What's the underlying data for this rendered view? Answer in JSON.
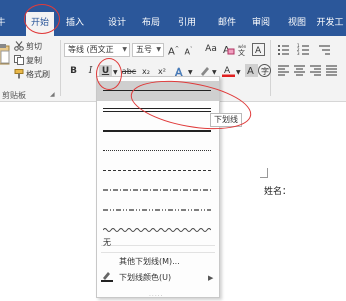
{
  "ribbon": {
    "tabs": [
      {
        "label": "开始",
        "active": true
      },
      {
        "label": "插入"
      },
      {
        "label": "设计"
      },
      {
        "label": "布局"
      },
      {
        "label": "引用"
      },
      {
        "label": "邮件"
      },
      {
        "label": "审阅"
      },
      {
        "label": "视图"
      },
      {
        "label": "开发工"
      }
    ],
    "clipboard": {
      "cut": "剪切",
      "copy": "复制",
      "format_painter": "格式刷",
      "group_label": "剪贴板"
    },
    "font": {
      "font_name": "等线 (西文正",
      "font_size": "五号",
      "grow": "A",
      "shrink": "A",
      "case": "Aa",
      "clear": "A",
      "phonetic": "wén",
      "bold": "B",
      "italic": "I",
      "underline": "U",
      "strike": "abc",
      "subscript": "x₂",
      "superscript": "x²",
      "effects": "A",
      "highlight": "ab",
      "font_color": "A",
      "char_shade": "A",
      "enclose": "A"
    }
  },
  "underline_menu": {
    "none_label": "无",
    "more_label": "其他下划线(M)...",
    "color_label": "下划线颜色(U)",
    "tooltip": "下划线"
  },
  "document": {
    "text": "姓名："
  },
  "colors": {
    "accent": "#2b579a",
    "annotation": "#e03a3a",
    "highlight_yellow": "#ffff00",
    "font_red": "#e02020"
  },
  "icons": [
    "scissors-icon",
    "copy-icon",
    "format-painter-icon",
    "paste-icon",
    "bullets-icon",
    "numbering-icon",
    "multilevel-icon",
    "indent-icon",
    "pen-icon"
  ]
}
